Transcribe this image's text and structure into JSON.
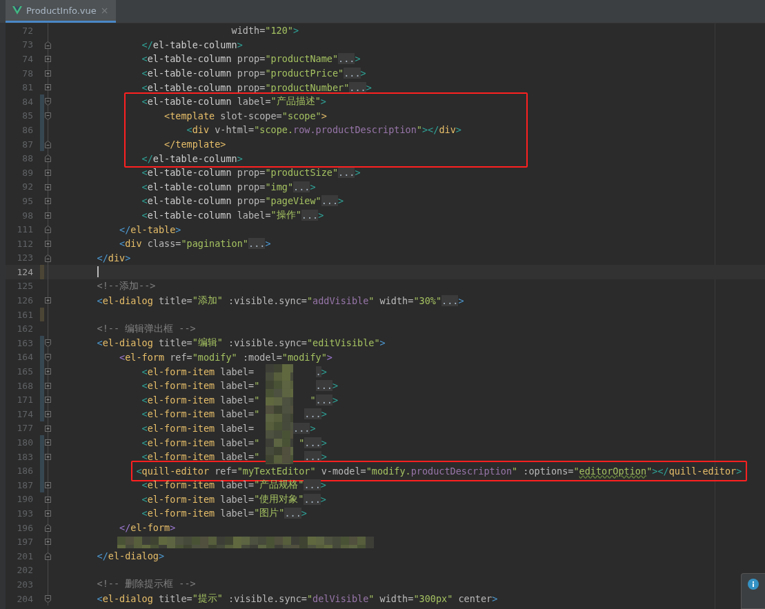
{
  "tab": {
    "label": "ProductInfo.vue",
    "selected": true,
    "close": "×"
  },
  "lines": [
    {
      "num": "72",
      "kind": "plain",
      "tokens": [
        {
          "kind": "at",
          "t": "                            width="
        },
        {
          "kind": "st",
          "t": "\"120\""
        },
        {
          "kind": "bt",
          "t": ">"
        }
      ]
    },
    {
      "num": "73",
      "kind": "close",
      "tokens": [
        {
          "kind": "bt",
          "t": "            </"
        },
        {
          "kind": "tl",
          "t": "el-table-column"
        },
        {
          "kind": "bt",
          "t": ">"
        }
      ]
    },
    {
      "num": "74",
      "kind": "plus",
      "tokens": [
        {
          "kind": "bt",
          "t": "            <"
        },
        {
          "kind": "tl",
          "t": "el-table-column"
        },
        {
          "kind": "at",
          "t": " prop="
        },
        {
          "kind": "st",
          "t": "\"productName\""
        },
        {
          "kind": "fd",
          "t": "..."
        },
        {
          "kind": "bt",
          "t": ">"
        }
      ]
    },
    {
      "num": "78",
      "kind": "plus",
      "tokens": [
        {
          "kind": "bt",
          "t": "            <"
        },
        {
          "kind": "tl",
          "t": "el-table-column"
        },
        {
          "kind": "at",
          "t": " prop="
        },
        {
          "kind": "st",
          "t": "\"productPrice\""
        },
        {
          "kind": "fd",
          "t": "..."
        },
        {
          "kind": "bt",
          "t": ">"
        }
      ]
    },
    {
      "num": "81",
      "kind": "plus",
      "tokens": [
        {
          "kind": "bt",
          "t": "            <"
        },
        {
          "kind": "tl",
          "t": "el-table-column"
        },
        {
          "kind": "at",
          "t": " prop="
        },
        {
          "kind": "st",
          "t": "\"productNumber\""
        },
        {
          "kind": "fd",
          "t": "..."
        },
        {
          "kind": "bt",
          "t": ">"
        }
      ]
    },
    {
      "num": "84",
      "kind": "open",
      "change": {
        "color": "#374752"
      },
      "tokens": [
        {
          "kind": "bt",
          "t": "            <"
        },
        {
          "kind": "tl",
          "t": "el-table-column"
        },
        {
          "kind": "at",
          "t": " label="
        },
        {
          "kind": "st",
          "t": "\"产品描述\""
        },
        {
          "kind": "bt",
          "t": ">"
        }
      ]
    },
    {
      "num": "85",
      "kind": "open",
      "change": {
        "color": "#374752"
      },
      "tokens": [
        {
          "kind": "tg",
          "t": "                <template"
        },
        {
          "kind": "at",
          "t": " slot-scope="
        },
        {
          "kind": "st",
          "t": "\"scope\""
        },
        {
          "kind": "tg",
          "t": ">"
        }
      ]
    },
    {
      "num": "86",
      "kind": "plain",
      "change": {
        "color": "#374752"
      },
      "tokens": [
        {
          "kind": "bt",
          "t": "                    <"
        },
        {
          "kind": "tg",
          "t": "div"
        },
        {
          "kind": "at",
          "t": " v-html="
        },
        {
          "kind": "st",
          "t": "\"scope."
        },
        {
          "kind": "sp",
          "t": "row.productDescription"
        },
        {
          "kind": "st",
          "t": "\""
        },
        {
          "kind": "bt",
          "t": "></"
        },
        {
          "kind": "tg",
          "t": "div"
        },
        {
          "kind": "bt",
          "t": ">"
        }
      ]
    },
    {
      "num": "87",
      "kind": "close",
      "change": {
        "color": "#374752"
      },
      "tokens": [
        {
          "kind": "tg",
          "t": "                </template>"
        }
      ]
    },
    {
      "num": "88",
      "kind": "close",
      "tokens": [
        {
          "kind": "bt",
          "t": "            </"
        },
        {
          "kind": "tl",
          "t": "el-table-column"
        },
        {
          "kind": "bt",
          "t": ">"
        }
      ]
    },
    {
      "num": "89",
      "kind": "plus",
      "tokens": [
        {
          "kind": "bt",
          "t": "            <"
        },
        {
          "kind": "tl",
          "t": "el-table-column"
        },
        {
          "kind": "at",
          "t": " prop="
        },
        {
          "kind": "st",
          "t": "\"productSize\""
        },
        {
          "kind": "fd",
          "t": "..."
        },
        {
          "kind": "bt",
          "t": ">"
        }
      ]
    },
    {
      "num": "92",
      "kind": "plus",
      "tokens": [
        {
          "kind": "bt",
          "t": "            <"
        },
        {
          "kind": "tl",
          "t": "el-table-column"
        },
        {
          "kind": "at",
          "t": " prop="
        },
        {
          "kind": "st",
          "t": "\"img\""
        },
        {
          "kind": "fd",
          "t": "..."
        },
        {
          "kind": "bt",
          "t": ">"
        }
      ]
    },
    {
      "num": "95",
      "kind": "plus",
      "tokens": [
        {
          "kind": "bt",
          "t": "            <"
        },
        {
          "kind": "tl",
          "t": "el-table-column"
        },
        {
          "kind": "at",
          "t": " prop="
        },
        {
          "kind": "st",
          "t": "\"pageView\""
        },
        {
          "kind": "fd",
          "t": "..."
        },
        {
          "kind": "bt",
          "t": ">"
        }
      ]
    },
    {
      "num": "98",
      "kind": "plus",
      "tokens": [
        {
          "kind": "bt",
          "t": "            <"
        },
        {
          "kind": "tl",
          "t": "el-table-column"
        },
        {
          "kind": "at",
          "t": " label="
        },
        {
          "kind": "st",
          "t": "\"操作\""
        },
        {
          "kind": "fd",
          "t": "..."
        },
        {
          "kind": "bt",
          "t": ">"
        }
      ]
    },
    {
      "num": "111",
      "kind": "close",
      "tokens": [
        {
          "kind": "bb",
          "t": "        </"
        },
        {
          "kind": "tg",
          "t": "el-table"
        },
        {
          "kind": "bb",
          "t": ">"
        }
      ]
    },
    {
      "num": "112",
      "kind": "plus",
      "tokens": [
        {
          "kind": "bb",
          "t": "        <"
        },
        {
          "kind": "tg",
          "t": "div"
        },
        {
          "kind": "at",
          "t": " class="
        },
        {
          "kind": "st",
          "t": "\"pagination\""
        },
        {
          "kind": "fd",
          "t": "..."
        },
        {
          "kind": "bb",
          "t": ">"
        }
      ]
    },
    {
      "num": "123",
      "kind": "close",
      "tokens": [
        {
          "kind": "bb",
          "t": "    </"
        },
        {
          "kind": "tg",
          "t": "div"
        },
        {
          "kind": "bb",
          "t": ">"
        }
      ]
    },
    {
      "num": "124",
      "kind": "plain",
      "change": {
        "color": "#4b4535"
      },
      "current": true
    },
    {
      "num": "125",
      "kind": "plain",
      "tokens": [
        {
          "kind": "cm",
          "t": "    <!--添加-->"
        }
      ]
    },
    {
      "num": "126",
      "kind": "plus",
      "tokens": [
        {
          "kind": "bb",
          "t": "    <"
        },
        {
          "kind": "tg",
          "t": "el-dialog"
        },
        {
          "kind": "at",
          "t": " title="
        },
        {
          "kind": "st",
          "t": "\"添加\""
        },
        {
          "kind": "at",
          "t": " :visible.sync="
        },
        {
          "kind": "st",
          "t": "\""
        },
        {
          "kind": "sp",
          "t": "addVisible"
        },
        {
          "kind": "st",
          "t": "\""
        },
        {
          "kind": "at",
          "t": " width="
        },
        {
          "kind": "st",
          "t": "\"30%\""
        },
        {
          "kind": "fd",
          "t": "..."
        },
        {
          "kind": "bb",
          "t": ">"
        }
      ]
    },
    {
      "num": "161",
      "kind": "plain",
      "change": {
        "color": "#4b4535"
      }
    },
    {
      "num": "162",
      "kind": "plain",
      "tokens": [
        {
          "kind": "cm",
          "t": "    <!-- 编辑弹出框 -->"
        }
      ]
    },
    {
      "num": "163",
      "kind": "open",
      "change": {
        "color": "#374752"
      },
      "tokens": [
        {
          "kind": "bb",
          "t": "    <"
        },
        {
          "kind": "tg",
          "t": "el-dialog"
        },
        {
          "kind": "at",
          "t": " title="
        },
        {
          "kind": "st",
          "t": "\"编辑\""
        },
        {
          "kind": "at",
          "t": " :visible.sync="
        },
        {
          "kind": "st",
          "t": "\"editVisible\""
        },
        {
          "kind": "bb",
          "t": ">"
        }
      ]
    },
    {
      "num": "164",
      "kind": "open",
      "change": {
        "color": "#374752"
      },
      "tokens": [
        {
          "kind": "bp",
          "t": "        <"
        },
        {
          "kind": "tg",
          "t": "el-form"
        },
        {
          "kind": "at",
          "t": " ref="
        },
        {
          "kind": "st",
          "t": "\"modify\""
        },
        {
          "kind": "at",
          "t": " :model="
        },
        {
          "kind": "st",
          "t": "\"modify\""
        },
        {
          "kind": "bp",
          "t": ">"
        }
      ]
    },
    {
      "num": "165",
      "kind": "plus",
      "change": {
        "color": "#374752"
      },
      "tokens": [
        {
          "kind": "bt",
          "t": "            <"
        },
        {
          "kind": "tg",
          "t": "el-form-item"
        },
        {
          "kind": "at",
          "t": " label=           "
        },
        {
          "kind": "fd",
          "t": "."
        },
        {
          "kind": "bt",
          "t": ">"
        }
      ]
    },
    {
      "num": "168",
      "kind": "plus",
      "change": {
        "color": "#374752"
      },
      "tokens": [
        {
          "kind": "bt",
          "t": "            <"
        },
        {
          "kind": "tg",
          "t": "el-form-item"
        },
        {
          "kind": "at",
          "t": " label="
        },
        {
          "kind": "st",
          "t": "\"          "
        },
        {
          "kind": "fd",
          "t": "..."
        },
        {
          "kind": "bt",
          "t": ">"
        }
      ]
    },
    {
      "num": "171",
      "kind": "plus",
      "change": {
        "color": "#374752"
      },
      "tokens": [
        {
          "kind": "bt",
          "t": "            <"
        },
        {
          "kind": "tg",
          "t": "el-form-item"
        },
        {
          "kind": "at",
          "t": " label="
        },
        {
          "kind": "st",
          "t": "\""
        },
        {
          "kind": "st",
          "t": "         \""
        },
        {
          "kind": "fd",
          "t": "..."
        },
        {
          "kind": "bt",
          "t": ">"
        }
      ]
    },
    {
      "num": "174",
      "kind": "plus",
      "change": {
        "color": "#374752"
      },
      "tokens": [
        {
          "kind": "bt",
          "t": "            <"
        },
        {
          "kind": "tg",
          "t": "el-form-item"
        },
        {
          "kind": "at",
          "t": " label="
        },
        {
          "kind": "st",
          "t": "\"        "
        },
        {
          "kind": "fd",
          "t": "..."
        },
        {
          "kind": "bt",
          "t": ">"
        }
      ]
    },
    {
      "num": "177",
      "kind": "plus",
      "tokens": [
        {
          "kind": "bt",
          "t": "            <"
        },
        {
          "kind": "tg",
          "t": "el-form-item"
        },
        {
          "kind": "at",
          "t": " label=       "
        },
        {
          "kind": "fd",
          "t": "..."
        },
        {
          "kind": "bt",
          "t": ">"
        }
      ]
    },
    {
      "num": "180",
      "kind": "plus",
      "change": {
        "color": "#374752"
      },
      "tokens": [
        {
          "kind": "bt",
          "t": "            <"
        },
        {
          "kind": "tg",
          "t": "el-form-item"
        },
        {
          "kind": "at",
          "t": " label="
        },
        {
          "kind": "st",
          "t": "\""
        },
        {
          "kind": "st",
          "t": "       \""
        },
        {
          "kind": "fd",
          "t": "..."
        },
        {
          "kind": "bt",
          "t": ">"
        }
      ]
    },
    {
      "num": "183",
      "kind": "plus",
      "change": {
        "color": "#374752"
      },
      "tokens": [
        {
          "kind": "bt",
          "t": "            <"
        },
        {
          "kind": "tg",
          "t": "el-form-item"
        },
        {
          "kind": "at",
          "t": " label="
        },
        {
          "kind": "st",
          "t": "\"        "
        },
        {
          "kind": "fd",
          "t": "..."
        },
        {
          "kind": "bt",
          "t": ">"
        }
      ]
    },
    {
      "num": "186",
      "kind": "plain",
      "change": {
        "color": "#374752"
      },
      "tokens": [
        {
          "kind": "bt",
          "t": "           <"
        },
        {
          "kind": "tg",
          "t": "quill-editor"
        },
        {
          "kind": "at",
          "t": " ref="
        },
        {
          "kind": "st",
          "t": "\"myTextEditor\""
        },
        {
          "kind": "at",
          "t": " v-model="
        },
        {
          "kind": "st",
          "t": "\"modify."
        },
        {
          "kind": "sp",
          "t": "productDescription"
        },
        {
          "kind": "st",
          "t": "\""
        },
        {
          "kind": "at",
          "t": " :options="
        },
        {
          "kind": "st",
          "t": "\""
        },
        {
          "kind": "ty",
          "t": "editorOption"
        },
        {
          "kind": "st",
          "t": "\""
        },
        {
          "kind": "bt",
          "t": "></"
        },
        {
          "kind": "tg",
          "t": "quill-editor"
        },
        {
          "kind": "bt",
          "t": ">"
        }
      ]
    },
    {
      "num": "187",
      "kind": "plus",
      "change": {
        "color": "#374752"
      },
      "tokens": [
        {
          "kind": "bt",
          "t": "            <"
        },
        {
          "kind": "tg",
          "t": "el-form-item"
        },
        {
          "kind": "at",
          "t": " label="
        },
        {
          "kind": "st",
          "t": "\"产品规格\""
        },
        {
          "kind": "fd",
          "t": "..."
        },
        {
          "kind": "bt",
          "t": ">"
        }
      ]
    },
    {
      "num": "190",
      "kind": "plus",
      "tokens": [
        {
          "kind": "bt",
          "t": "            <"
        },
        {
          "kind": "tg",
          "t": "el-form-item"
        },
        {
          "kind": "at",
          "t": " label="
        },
        {
          "kind": "st",
          "t": "\"使用对象\""
        },
        {
          "kind": "fd",
          "t": "..."
        },
        {
          "kind": "bt",
          "t": ">"
        }
      ]
    },
    {
      "num": "193",
      "kind": "plus",
      "tokens": [
        {
          "kind": "bt",
          "t": "            <"
        },
        {
          "kind": "tg",
          "t": "el-form-item"
        },
        {
          "kind": "at",
          "t": " label="
        },
        {
          "kind": "st",
          "t": "\"图片\""
        },
        {
          "kind": "fd",
          "t": "..."
        },
        {
          "kind": "bt",
          "t": ">"
        }
      ]
    },
    {
      "num": "196",
      "kind": "close",
      "tokens": [
        {
          "kind": "bp",
          "t": "        </"
        },
        {
          "kind": "tg",
          "t": "el-form"
        },
        {
          "kind": "bp",
          "t": ">"
        }
      ]
    },
    {
      "num": "197",
      "kind": "plus"
    },
    {
      "num": "201",
      "kind": "close",
      "tokens": [
        {
          "kind": "bb",
          "t": "    </"
        },
        {
          "kind": "tg",
          "t": "el-dialog"
        },
        {
          "kind": "bb",
          "t": ">"
        }
      ]
    },
    {
      "num": "202",
      "kind": "plain"
    },
    {
      "num": "203",
      "kind": "plain",
      "tokens": [
        {
          "kind": "cm",
          "t": "    <!-- 删除提示框 -->"
        }
      ]
    },
    {
      "num": "204",
      "kind": "open",
      "tokens": [
        {
          "kind": "bb",
          "t": "    <"
        },
        {
          "kind": "tg",
          "t": "el-dialog"
        },
        {
          "kind": "at",
          "t": " title="
        },
        {
          "kind": "st",
          "t": "\"提示\""
        },
        {
          "kind": "at",
          "t": " :visible.sync="
        },
        {
          "kind": "st",
          "t": "\""
        },
        {
          "kind": "sp",
          "t": "delVisible"
        },
        {
          "kind": "st",
          "t": "\""
        },
        {
          "kind": "at",
          "t": " width="
        },
        {
          "kind": "st",
          "t": "\"300px\""
        },
        {
          "kind": "at",
          "t": " center"
        },
        {
          "kind": "bb",
          "t": ">"
        }
      ]
    }
  ],
  "annotations": [
    {
      "kind": "frame"
    },
    {
      "kind": "line-frame"
    },
    {
      "kind": "mosaic"
    },
    {
      "kind": "mosaic"
    }
  ],
  "notification": {
    "kind": "info"
  }
}
